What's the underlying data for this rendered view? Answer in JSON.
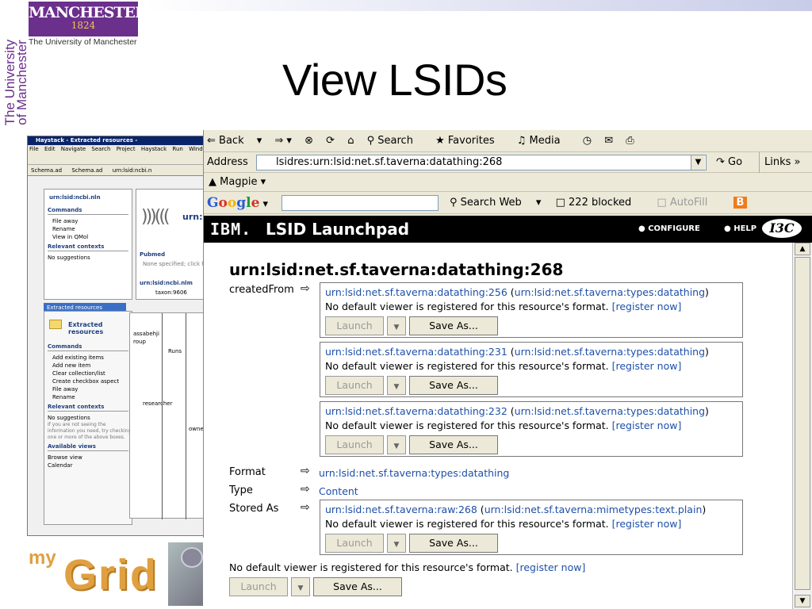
{
  "slide": {
    "title": "View LSIDs",
    "logo_name": "MANCHESTER",
    "logo_year": "1824",
    "university_name": "The University of Manchester",
    "vertical_text": "The University of Manchester",
    "mygrid_my": "my",
    "mygrid_grid": "Grid"
  },
  "haystack": {
    "title": "Haystack - Extracted resources -",
    "menu": [
      "File",
      "Edit",
      "Navigate",
      "Search",
      "Project",
      "Haystack",
      "Run",
      "Wind"
    ],
    "tabs": [
      "Schema.ad",
      "Schema.ad",
      "urn:lsid:ncbi.n"
    ],
    "left_header": "urn:lsid:ncbi.nln",
    "commands_header": "Commands",
    "commands": [
      "File away",
      "Rename",
      "View in QMol"
    ],
    "relevant_header": "Relevant contexts",
    "no_suggestions": "No suggestions",
    "right_urn": "urn:",
    "pubmed": "Pubmed",
    "pubmed_note": "None specified; click he",
    "right_urn2": "urn:lsid:ncbi.nlm",
    "taxon": "taxon:9606",
    "extracted_tab": "Extracted resources",
    "extracted_label": "Extracted resources",
    "commands2": [
      "Add existing items",
      "Add new item",
      "Clear collection/list",
      "Create checkbox aspect",
      "File away",
      "Rename"
    ],
    "relevant2": "Relevant contexts",
    "no_suggestions2": "No suggestions",
    "hint": "If you are not seeing the information you need, try checking one or more of the above boxes.",
    "available_views": "Available views",
    "views": [
      "Browse view",
      "Calendar"
    ],
    "graph_labels": [
      "assabehji",
      "roup",
      "Runs",
      "researcher",
      "owne"
    ]
  },
  "browser": {
    "toolbar": [
      "Back",
      "Search",
      "Favorites",
      "Media"
    ],
    "address_label": "Address",
    "address_value": "lsidres:urn:lsid:net.sf.taverna:datathing:268",
    "go_label": "Go",
    "links_label": "Links",
    "magpie_label": "Magpie",
    "google_label": "Google",
    "search_web": "Search Web",
    "blocked": "222 blocked",
    "autofill": "AutoFill"
  },
  "lsid": {
    "ibm": "IBM.",
    "launchpad": "LSID Launchpad",
    "configure": "CONFIGURE",
    "help": "HELP",
    "i3c": "I3C",
    "resource_title": "urn:lsid:net.sf.taverna:datathing:268",
    "created_from_label": "createdFrom",
    "created_from": [
      {
        "urn": "urn:lsid:net.sf.taverna:datathing:256",
        "type": "urn:lsid:net.sf.taverna:types:datathing"
      },
      {
        "urn": "urn:lsid:net.sf.taverna:datathing:231",
        "type": "urn:lsid:net.sf.taverna:types:datathing"
      },
      {
        "urn": "urn:lsid:net.sf.taverna:datathing:232",
        "type": "urn:lsid:net.sf.taverna:types:datathing"
      }
    ],
    "no_viewer": "No default viewer is registered for this resource's format.",
    "register_now": "[register now]",
    "launch_label": "Launch",
    "save_as_label": "Save As...",
    "format_label": "Format",
    "format_value": "urn:lsid:net.sf.taverna:types:datathing",
    "type_label": "Type",
    "type_value": "Content",
    "stored_as_label": "Stored As",
    "stored_as": {
      "urn": "urn:lsid:net.sf.taverna:raw:268",
      "type": "urn:lsid:net.sf.taverna:mimetypes:text.plain"
    },
    "bottom_no_viewer": "No default viewer is registered for this resource's format."
  }
}
